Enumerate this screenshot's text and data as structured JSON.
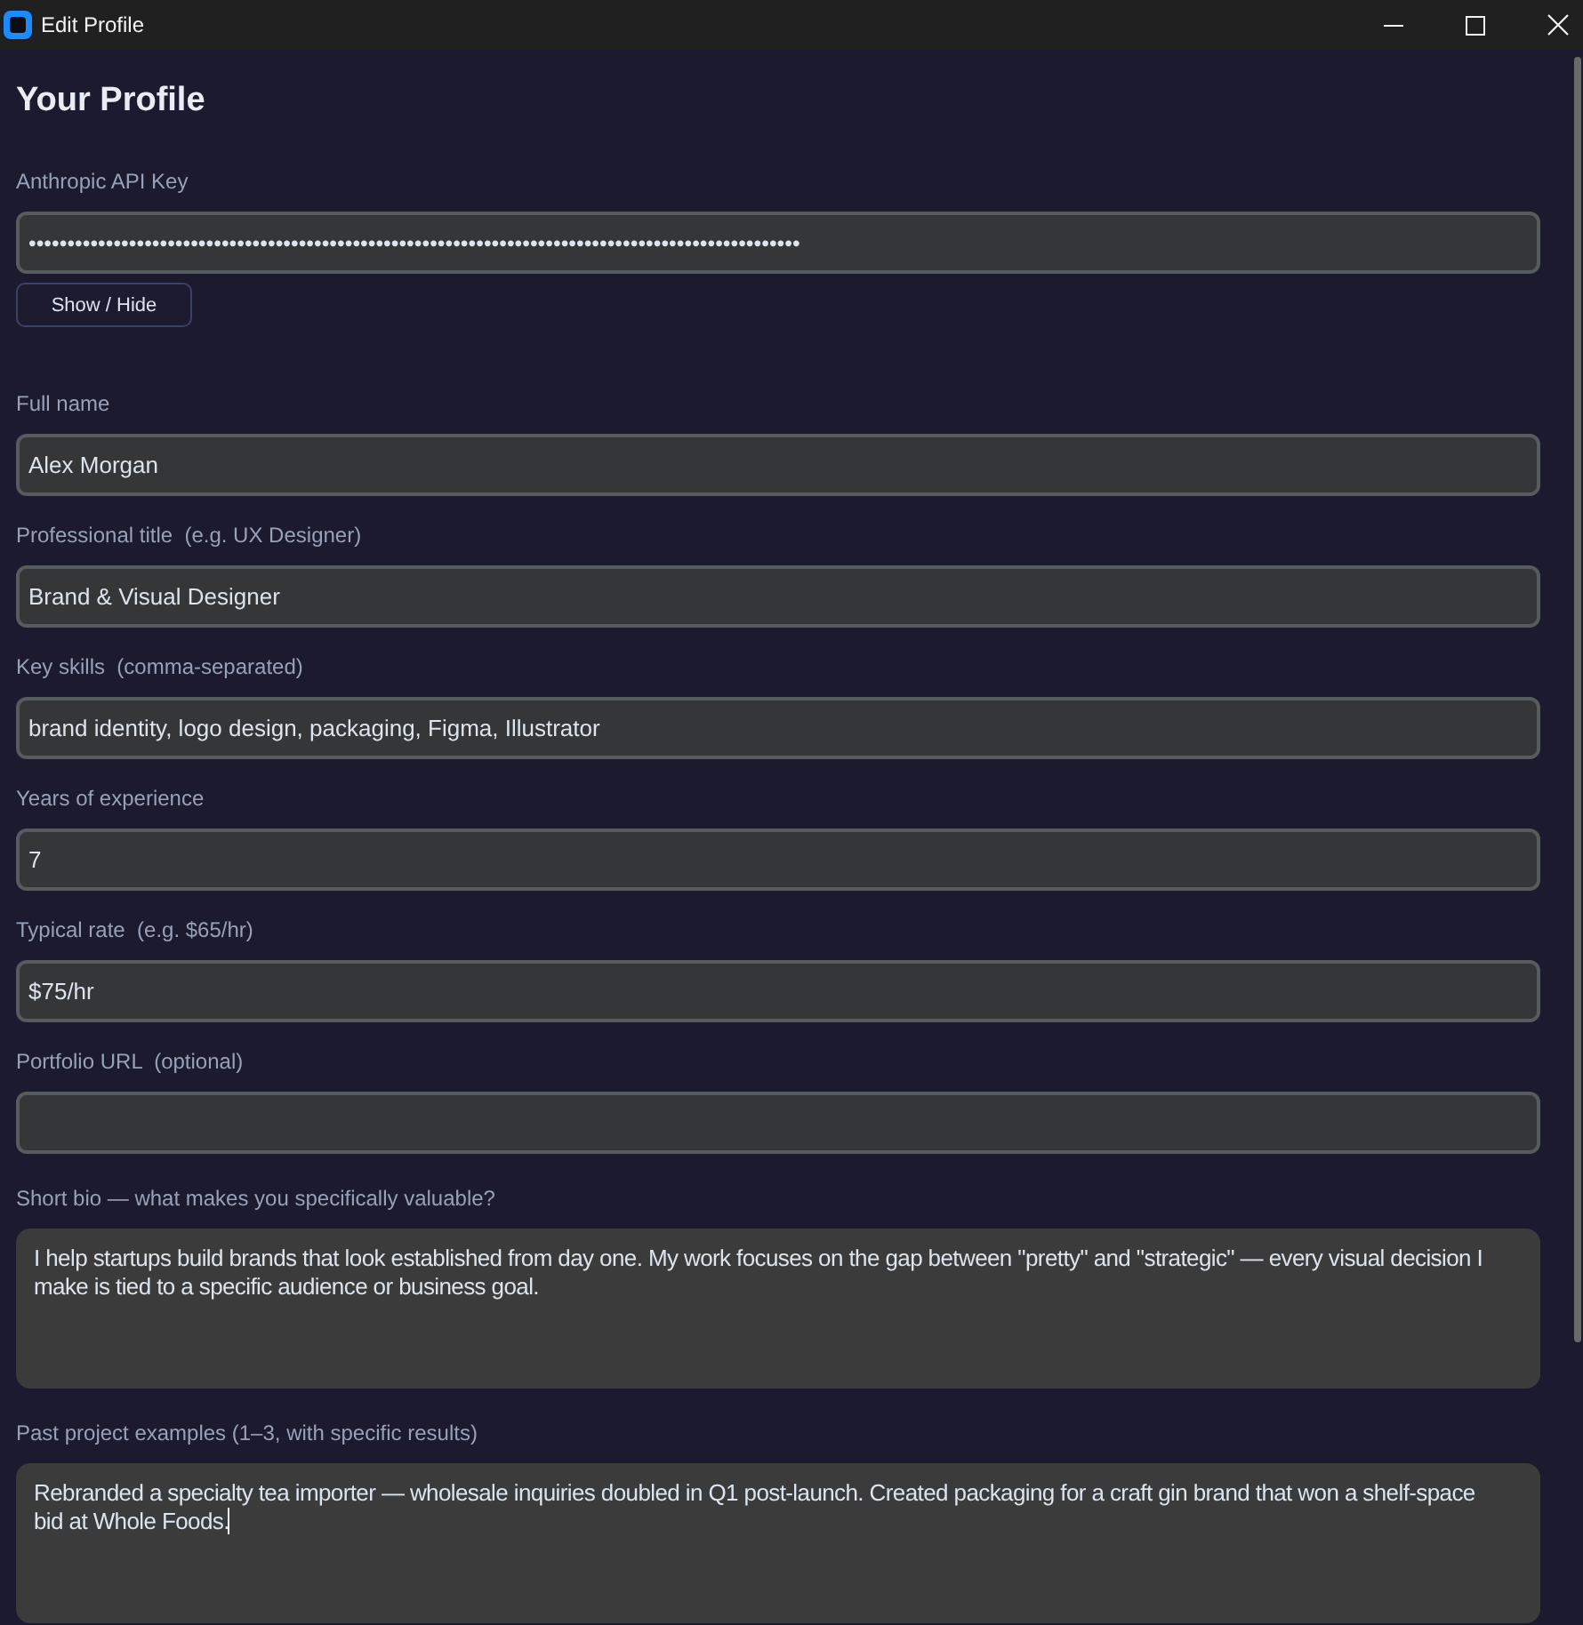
{
  "window": {
    "title": "Edit Profile"
  },
  "heading": "Your Profile",
  "api_key": {
    "label": "Anthropic API Key",
    "value": "••••••••••••••••••••••••••••••••••••••••••••••••••••••••••••••••••••••••••••••••••••••••••••••••••••"
  },
  "show_hide_button": {
    "label": "Show / Hide"
  },
  "fields": [
    {
      "kind": "line",
      "label": "Full name",
      "value": "Alex Morgan",
      "focused": false
    },
    {
      "kind": "line",
      "label": "Professional title  (e.g. UX Designer)",
      "value": "Brand & Visual Designer",
      "focused": false
    },
    {
      "kind": "line",
      "label": "Key skills  (comma-separated)",
      "value": "brand identity, logo design, packaging, Figma, Illustrator",
      "focused": false
    },
    {
      "kind": "line",
      "label": "Years of experience",
      "value": "7",
      "focused": false
    },
    {
      "kind": "line",
      "label": "Typical rate  (e.g. $65/hr)",
      "value": "$75/hr",
      "focused": false
    },
    {
      "kind": "line",
      "label": "Portfolio URL  (optional)",
      "focused": false
    },
    {
      "kind": "multiline",
      "label": "Short bio — what makes you specifically valuable?",
      "value": "I help startups build brands that look established from day one. My work focuses on the gap between \"pretty\" and \"strategic\" — every visual decision I make is tied to a specific audience or business goal.",
      "focused": false
    },
    {
      "kind": "multiline",
      "label": "Past project examples (1–3, with specific results)",
      "value": "Rebranded a specialty tea importer — wholesale inquiries doubled in Q1 post-launch. Created packaging for a craft gin brand that won a shelf-space bid at Whole Foods.",
      "focused": true
    }
  ]
}
